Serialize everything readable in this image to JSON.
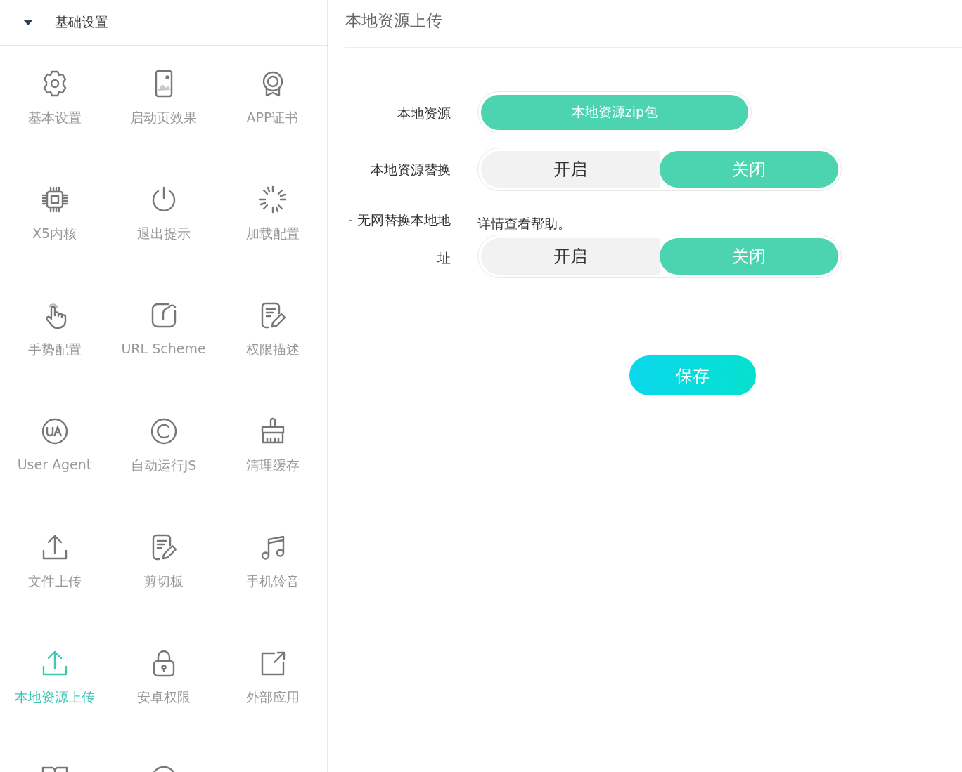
{
  "sidebar": {
    "header": {
      "title": "基础设置",
      "expanded": true
    },
    "items": [
      {
        "label": "基本设置",
        "kind": "gear",
        "selected": false
      },
      {
        "label": "启动页效果",
        "kind": "phone",
        "selected": false
      },
      {
        "label": "APP证书",
        "kind": "medal",
        "selected": false
      },
      {
        "label": "X5内核",
        "kind": "chip",
        "selected": false
      },
      {
        "label": "退出提示",
        "kind": "power",
        "selected": false
      },
      {
        "label": "加载配置",
        "kind": "spinner",
        "selected": false
      },
      {
        "label": "手势配置",
        "kind": "hand",
        "selected": false
      },
      {
        "label": "URL Scheme",
        "kind": "scheme",
        "selected": false
      },
      {
        "label": "权限描述",
        "kind": "note",
        "selected": false
      },
      {
        "label": "User Agent",
        "kind": "ua",
        "selected": false
      },
      {
        "label": "自动运行JS",
        "kind": "copyright",
        "selected": false
      },
      {
        "label": "清理缓存",
        "kind": "brush",
        "selected": false
      },
      {
        "label": "文件上传",
        "kind": "upload",
        "selected": false
      },
      {
        "label": "剪切板",
        "kind": "note",
        "selected": false
      },
      {
        "label": "手机铃音",
        "kind": "music",
        "selected": false
      },
      {
        "label": "本地资源上传",
        "kind": "upload",
        "selected": true
      },
      {
        "label": "安卓权限",
        "kind": "lock",
        "selected": false
      },
      {
        "label": "外部应用",
        "kind": "external",
        "selected": false
      },
      {
        "kind": "book",
        "selected": false
      },
      {
        "kind": "circle",
        "selected": false
      }
    ]
  },
  "panel": {
    "title": "本地资源上传",
    "rows": [
      {
        "kind": "upload",
        "label": "本地资源",
        "button": "本地资源zip包"
      },
      {
        "kind": "toggle",
        "label": "本地资源替换",
        "options": [
          {
            "label": "开启",
            "selected": false
          },
          {
            "label": "关闭",
            "selected": true
          }
        ]
      },
      {
        "kind": "note",
        "label": "- 无网替换本地地址",
        "text": "详情查看帮助。"
      },
      {
        "kind": "toggle",
        "options": [
          {
            "label": "开启",
            "selected": false
          },
          {
            "label": "关闭",
            "selected": true
          }
        ]
      }
    ],
    "save": "保存"
  }
}
